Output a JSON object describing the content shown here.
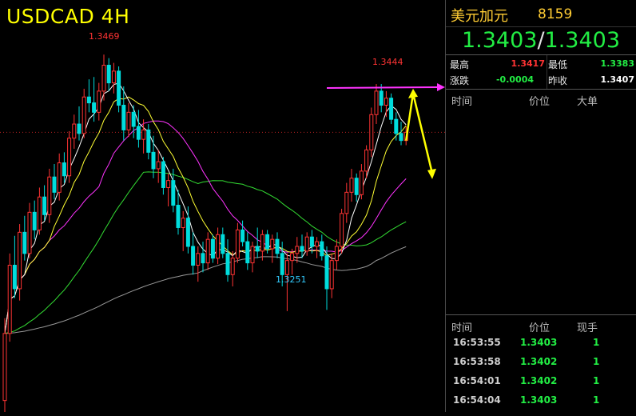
{
  "chart_data": {
    "type": "candlestick",
    "symbol_title": "USDCAD 4H",
    "annotations": [
      {
        "text": "1.3469",
        "role": "high",
        "color": "#ff3333"
      },
      {
        "text": "1.3444",
        "role": "recent-high",
        "color": "#ff3333"
      },
      {
        "text": "1.3251",
        "role": "low",
        "color": "#33ccff"
      }
    ],
    "ylim": [
      1.317,
      1.351
    ],
    "candles": [
      [
        1.3175,
        1.3245,
        1.3165,
        1.3232
      ],
      [
        1.3232,
        1.33,
        1.3225,
        1.329
      ],
      [
        1.329,
        1.3315,
        1.3262,
        1.327
      ],
      [
        1.327,
        1.3325,
        1.326,
        1.3318
      ],
      [
        1.3318,
        1.3332,
        1.3294,
        1.33
      ],
      [
        1.33,
        1.3343,
        1.3296,
        1.3335
      ],
      [
        1.3335,
        1.3345,
        1.3312,
        1.332
      ],
      [
        1.332,
        1.3356,
        1.3316,
        1.3348
      ],
      [
        1.3348,
        1.3358,
        1.3328,
        1.3333
      ],
      [
        1.3333,
        1.3372,
        1.3326,
        1.3365
      ],
      [
        1.3365,
        1.3376,
        1.3346,
        1.3352
      ],
      [
        1.3352,
        1.3385,
        1.3345,
        1.3377
      ],
      [
        1.3377,
        1.3386,
        1.336,
        1.3366
      ],
      [
        1.3366,
        1.3404,
        1.336,
        1.3398
      ],
      [
        1.3398,
        1.3418,
        1.3389,
        1.341
      ],
      [
        1.341,
        1.3425,
        1.3396,
        1.3402
      ],
      [
        1.3402,
        1.344,
        1.3398,
        1.3433
      ],
      [
        1.3433,
        1.3448,
        1.342,
        1.3428
      ],
      [
        1.3428,
        1.345,
        1.3412,
        1.342
      ],
      [
        1.342,
        1.3445,
        1.3413,
        1.3438
      ],
      [
        1.3438,
        1.3469,
        1.343,
        1.346
      ],
      [
        1.346,
        1.3466,
        1.3438,
        1.3445
      ],
      [
        1.3445,
        1.3462,
        1.3436,
        1.3455
      ],
      [
        1.3455,
        1.3459,
        1.342,
        1.3426
      ],
      [
        1.3426,
        1.3442,
        1.3396,
        1.3405
      ],
      [
        1.3405,
        1.3428,
        1.3399,
        1.342
      ],
      [
        1.342,
        1.3426,
        1.3398,
        1.3408
      ],
      [
        1.3408,
        1.3422,
        1.339,
        1.3397
      ],
      [
        1.3397,
        1.3414,
        1.3385,
        1.3405
      ],
      [
        1.3405,
        1.341,
        1.338,
        1.3386
      ],
      [
        1.3386,
        1.34,
        1.3364,
        1.3372
      ],
      [
        1.3372,
        1.3388,
        1.336,
        1.3378
      ],
      [
        1.3378,
        1.3382,
        1.335,
        1.3356
      ],
      [
        1.3356,
        1.3368,
        1.334,
        1.3362
      ],
      [
        1.3362,
        1.3372,
        1.3335,
        1.3341
      ],
      [
        1.3341,
        1.3354,
        1.3316,
        1.3322
      ],
      [
        1.3322,
        1.3336,
        1.3302,
        1.333
      ],
      [
        1.333,
        1.334,
        1.33,
        1.3306
      ],
      [
        1.3306,
        1.3318,
        1.3282,
        1.329
      ],
      [
        1.329,
        1.3306,
        1.3276,
        1.33
      ],
      [
        1.33,
        1.331,
        1.3284,
        1.3292
      ],
      [
        1.3292,
        1.3318,
        1.3286,
        1.3312
      ],
      [
        1.3312,
        1.3316,
        1.3292,
        1.3296
      ],
      [
        1.3296,
        1.3322,
        1.3291,
        1.3316
      ],
      [
        1.3316,
        1.3322,
        1.3296,
        1.33
      ],
      [
        1.33,
        1.3312,
        1.3276,
        1.3282
      ],
      [
        1.3282,
        1.3302,
        1.3272,
        1.3296
      ],
      [
        1.3296,
        1.3326,
        1.3292,
        1.332
      ],
      [
        1.332,
        1.3328,
        1.3306,
        1.331
      ],
      [
        1.331,
        1.3318,
        1.3286,
        1.3292
      ],
      [
        1.3292,
        1.331,
        1.3284,
        1.3306
      ],
      [
        1.3306,
        1.3322,
        1.3296,
        1.3302
      ],
      [
        1.3302,
        1.332,
        1.3294,
        1.3316
      ],
      [
        1.3316,
        1.332,
        1.33,
        1.3304
      ],
      [
        1.3304,
        1.3316,
        1.3292,
        1.3312
      ],
      [
        1.3312,
        1.3318,
        1.3296,
        1.33
      ],
      [
        1.33,
        1.331,
        1.3272,
        1.3282
      ],
      [
        1.3282,
        1.33,
        1.3251,
        1.3294
      ],
      [
        1.3294,
        1.3304,
        1.3282,
        1.33
      ],
      [
        1.33,
        1.3314,
        1.3292,
        1.3306
      ],
      [
        1.3306,
        1.3316,
        1.3296,
        1.3302
      ],
      [
        1.3302,
        1.3318,
        1.3298,
        1.3314
      ],
      [
        1.3314,
        1.332,
        1.33,
        1.3306
      ],
      [
        1.3306,
        1.3314,
        1.3296,
        1.331
      ],
      [
        1.331,
        1.3316,
        1.3294,
        1.3298
      ],
      [
        1.3298,
        1.3306,
        1.3252,
        1.327
      ],
      [
        1.327,
        1.33,
        1.3262,
        1.3294
      ],
      [
        1.3294,
        1.3312,
        1.3286,
        1.3306
      ],
      [
        1.3306,
        1.3338,
        1.33,
        1.3334
      ],
      [
        1.3334,
        1.336,
        1.3326,
        1.3352
      ],
      [
        1.3352,
        1.3372,
        1.3344,
        1.3364
      ],
      [
        1.3364,
        1.3368,
        1.3344,
        1.335
      ],
      [
        1.335,
        1.3376,
        1.3346,
        1.337
      ],
      [
        1.337,
        1.3392,
        1.3364,
        1.3388
      ],
      [
        1.3388,
        1.3424,
        1.3382,
        1.3418
      ],
      [
        1.3418,
        1.3444,
        1.341,
        1.3438
      ],
      [
        1.3438,
        1.3444,
        1.342,
        1.3426
      ],
      [
        1.3426,
        1.3438,
        1.3416,
        1.3432
      ],
      [
        1.3432,
        1.3436,
        1.341,
        1.3414
      ],
      [
        1.3414,
        1.342,
        1.3396,
        1.3402
      ],
      [
        1.3402,
        1.3412,
        1.3392,
        1.3396
      ],
      [
        1.3396,
        1.3408,
        1.3392,
        1.3403
      ]
    ],
    "moving_averages": [
      {
        "color": "#ffffff",
        "period": 5
      },
      {
        "color": "#ffff33",
        "period": 10
      },
      {
        "color": "#ff33ff",
        "period": 20
      },
      {
        "color": "#33dd33",
        "period": 60
      },
      {
        "color": "#999999",
        "period": 120
      }
    ],
    "reference_line": {
      "value": 1.3403,
      "color": "#bb2222",
      "style": "dotted"
    },
    "drawings": [
      {
        "type": "arrow",
        "color": "#ff33ff",
        "from": 1.344,
        "to": 1.344
      },
      {
        "type": "path-arrow",
        "color": "#ffff00",
        "points": [
          1.3396,
          1.3436,
          1.3368
        ]
      }
    ]
  },
  "panel": {
    "pair_name": "美元加元",
    "pair_code": "8159",
    "bid": "1.3403",
    "ask": "1.3403",
    "separator": "/",
    "stats": {
      "high_label": "最高",
      "high": "1.3417",
      "low_label": "最低",
      "low": "1.3383",
      "change_label": "涨跌",
      "change": "-0.0004",
      "prev_label": "昨收",
      "prev": "1.3407"
    },
    "big_orders_headers": [
      "时间",
      "价位",
      "大单"
    ],
    "ticks_headers": [
      "时间",
      "价位",
      "现手"
    ],
    "ticks": [
      {
        "time": "16:53:55",
        "price": "1.3403",
        "vol": "1"
      },
      {
        "time": "16:53:58",
        "price": "1.3402",
        "vol": "1"
      },
      {
        "time": "16:54:01",
        "price": "1.3402",
        "vol": "1"
      },
      {
        "time": "16:54:04",
        "price": "1.3403",
        "vol": "1"
      }
    ],
    "colors": {
      "up": "#ff3333",
      "down": "#22ee44",
      "neutral": "#ffffff",
      "accent": "#ffcc33"
    }
  }
}
